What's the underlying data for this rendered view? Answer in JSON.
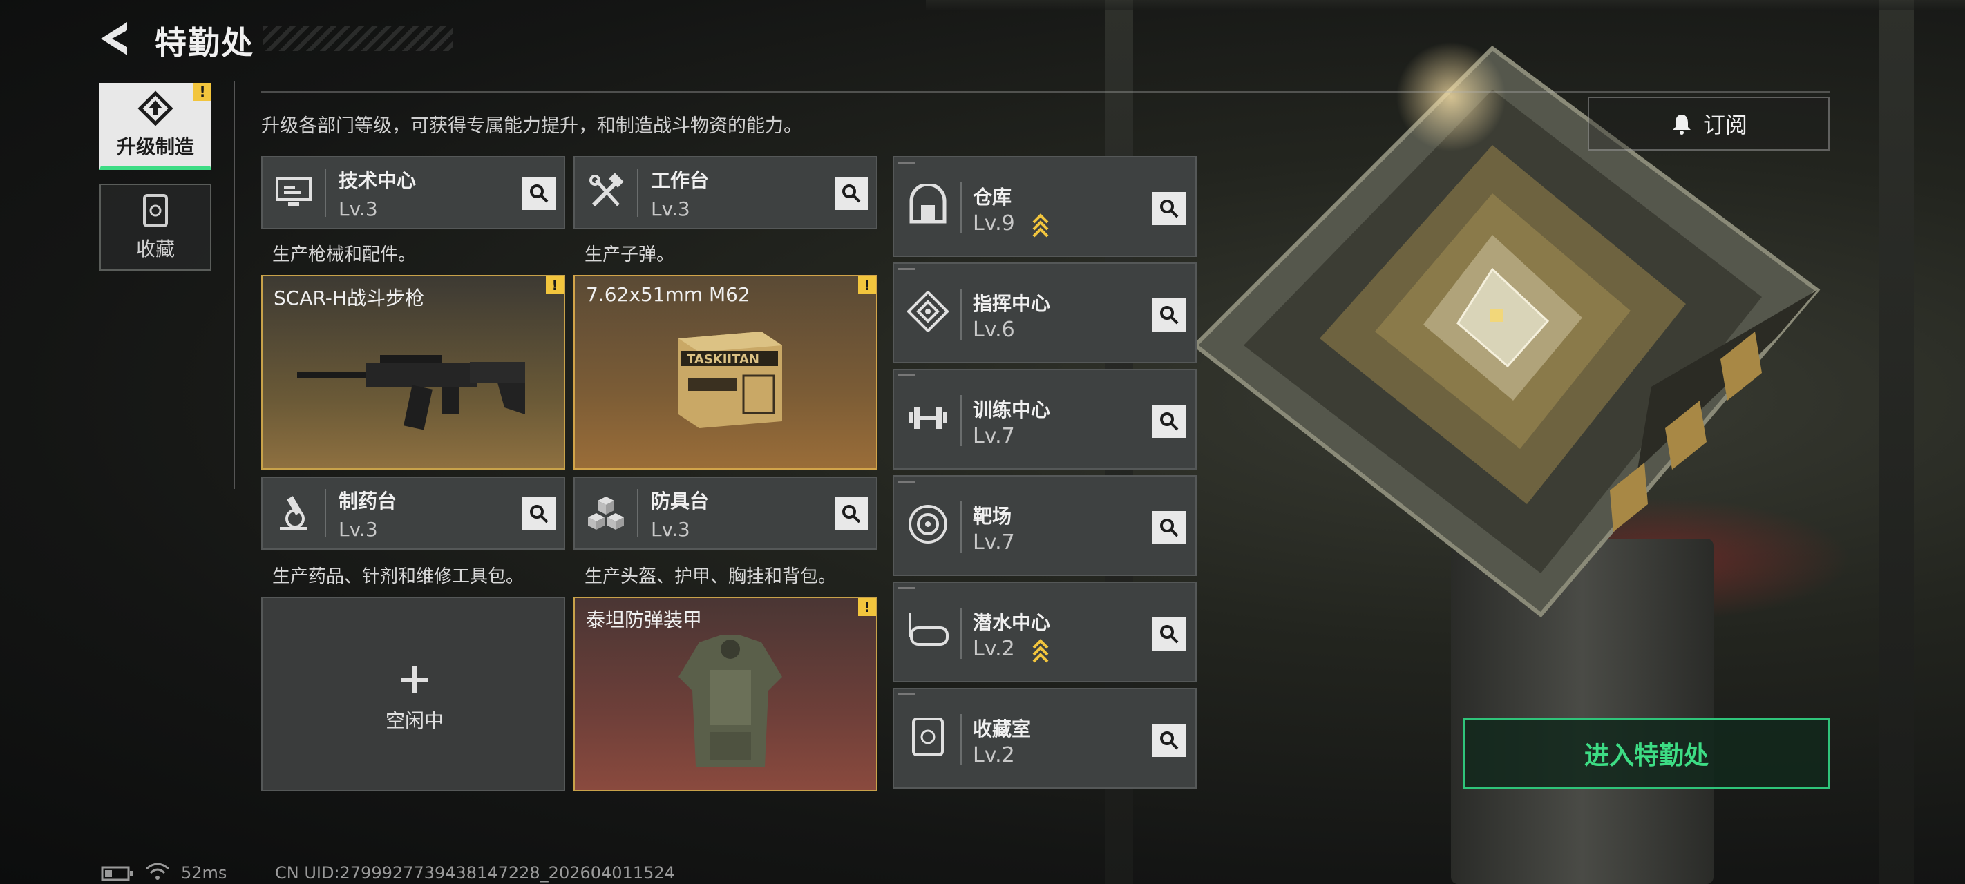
{
  "header": {
    "title": "特勤处"
  },
  "sidebar": {
    "tabs": [
      {
        "label": "升级制造"
      },
      {
        "label": "收藏"
      }
    ]
  },
  "description": "升级各部门等级，可获得专属能力提升，和制造战斗物资的能力。",
  "subscribe_label": "订阅",
  "badge_mark": "!",
  "stations": [
    {
      "name": "技术中心",
      "level": "Lv.3",
      "product": "生产枪械和配件。",
      "slot": "SCAR-H战斗步枪"
    },
    {
      "name": "工作台",
      "level": "Lv.3",
      "product": "生产子弹。",
      "slot": "7.62x51mm M62"
    },
    {
      "name": "制药台",
      "level": "Lv.3",
      "product": "生产药品、针剂和维修工具包。",
      "slot": "空闲中"
    },
    {
      "name": "防具台",
      "level": "Lv.3",
      "product": "生产头盔、护甲、胸挂和背包。",
      "slot": "泰坦防弹装甲"
    }
  ],
  "facilities": [
    {
      "name": "仓库",
      "level": "Lv.9",
      "upgradable": true
    },
    {
      "name": "指挥中心",
      "level": "Lv.6",
      "upgradable": false
    },
    {
      "name": "训练中心",
      "level": "Lv.7",
      "upgradable": false
    },
    {
      "name": "靶场",
      "level": "Lv.7",
      "upgradable": false
    },
    {
      "name": "潜水中心",
      "level": "Lv.2",
      "upgradable": true
    },
    {
      "name": "收藏室",
      "level": "Lv.2",
      "upgradable": false
    }
  ],
  "enter_label": "进入特勤处",
  "status_bar": {
    "ping": "52ms",
    "uid": "CN UID:279992773943814722​8_202604011524"
  },
  "ammo_box_text": "TASKIITAN",
  "colors": {
    "accent_green": "#3ddc84",
    "badge_yellow": "#f2c53d",
    "gold_border": "#c8a24a"
  }
}
